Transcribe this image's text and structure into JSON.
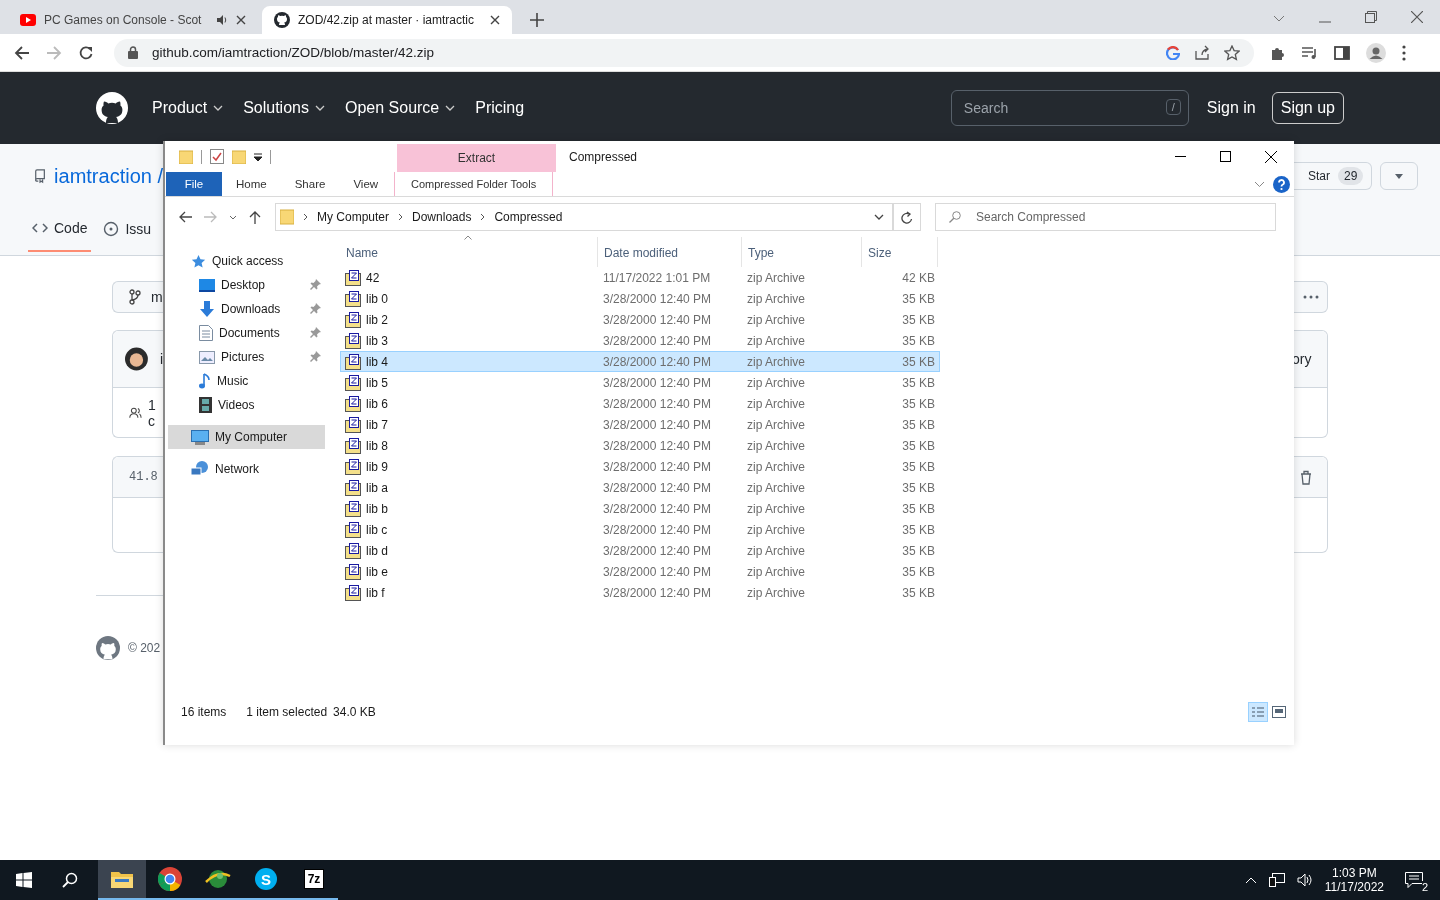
{
  "browser": {
    "tabs": [
      {
        "title": "PC Games on Console - Scot",
        "selected": false,
        "audio": true,
        "kind": "video"
      },
      {
        "title": "ZOD/42.zip at master · iamtractic",
        "selected": true,
        "audio": false,
        "kind": "github"
      }
    ],
    "url": "github.com/iamtraction/ZOD/blob/master/42.zip"
  },
  "github": {
    "nav": [
      {
        "label": "Product",
        "dropdown": true
      },
      {
        "label": "Solutions",
        "dropdown": true
      },
      {
        "label": "Open Source",
        "dropdown": true
      },
      {
        "label": "Pricing",
        "dropdown": false
      }
    ],
    "search": {
      "placeholder": "Search",
      "key": "/"
    },
    "sign_in": "Sign in",
    "sign_up": "Sign up",
    "owner": "iamtraction /",
    "repo_tabs": [
      {
        "label": "Code",
        "selected": true
      },
      {
        "label": "Issu",
        "selected": false
      }
    ],
    "branch": "m",
    "commit_author": "i",
    "contributors": "1 c",
    "file_size": "41.8",
    "footer": "© 202",
    "star": {
      "label": "Star",
      "count": "29"
    },
    "history": "ory"
  },
  "explorer": {
    "title": "Compressed",
    "context_tab": "Extract",
    "ribbon_tabs": [
      {
        "label": "File",
        "kind": "file"
      },
      {
        "label": "Home",
        "kind": "tab"
      },
      {
        "label": "Share",
        "kind": "tab"
      },
      {
        "label": "View",
        "kind": "tab"
      },
      {
        "label": "Compressed Folder Tools",
        "kind": "context"
      }
    ],
    "breadcrumbs": [
      "My Computer",
      "Downloads",
      "Compressed"
    ],
    "search": {
      "placeholder": "Search Compressed"
    },
    "nav": [
      {
        "label": "Quick access",
        "kind": "quick",
        "selected": false,
        "children": [
          {
            "label": "Desktop",
            "kind": "desktop",
            "pinned": true,
            "selected": false
          },
          {
            "label": "Downloads",
            "kind": "downloads",
            "pinned": true,
            "selected": false
          },
          {
            "label": "Documents",
            "kind": "documents",
            "pinned": true,
            "selected": false
          },
          {
            "label": "Pictures",
            "kind": "pictures",
            "pinned": true,
            "selected": false
          },
          {
            "label": "Music",
            "kind": "music",
            "pinned": false,
            "selected": false
          },
          {
            "label": "Videos",
            "kind": "videos",
            "pinned": false,
            "selected": false
          }
        ]
      },
      {
        "label": "My Computer",
        "kind": "computer",
        "selected": true
      },
      {
        "label": "Network",
        "kind": "network",
        "selected": false
      }
    ],
    "columns": [
      "Name",
      "Date modified",
      "Type",
      "Size"
    ],
    "files": [
      {
        "name": "42",
        "date": "11/17/2022 1:01 PM",
        "type": "zip Archive",
        "size": "42 KB",
        "selected": false
      },
      {
        "name": "lib 0",
        "date": "3/28/2000 12:40 PM",
        "type": "zip Archive",
        "size": "35 KB",
        "selected": false
      },
      {
        "name": "lib 2",
        "date": "3/28/2000 12:40 PM",
        "type": "zip Archive",
        "size": "35 KB",
        "selected": false
      },
      {
        "name": "lib 3",
        "date": "3/28/2000 12:40 PM",
        "type": "zip Archive",
        "size": "35 KB",
        "selected": false
      },
      {
        "name": "lib 4",
        "date": "3/28/2000 12:40 PM",
        "type": "zip Archive",
        "size": "35 KB",
        "selected": true
      },
      {
        "name": "lib 5",
        "date": "3/28/2000 12:40 PM",
        "type": "zip Archive",
        "size": "35 KB",
        "selected": false
      },
      {
        "name": "lib 6",
        "date": "3/28/2000 12:40 PM",
        "type": "zip Archive",
        "size": "35 KB",
        "selected": false
      },
      {
        "name": "lib 7",
        "date": "3/28/2000 12:40 PM",
        "type": "zip Archive",
        "size": "35 KB",
        "selected": false
      },
      {
        "name": "lib 8",
        "date": "3/28/2000 12:40 PM",
        "type": "zip Archive",
        "size": "35 KB",
        "selected": false
      },
      {
        "name": "lib 9",
        "date": "3/28/2000 12:40 PM",
        "type": "zip Archive",
        "size": "35 KB",
        "selected": false
      },
      {
        "name": "lib a",
        "date": "3/28/2000 12:40 PM",
        "type": "zip Archive",
        "size": "35 KB",
        "selected": false
      },
      {
        "name": "lib b",
        "date": "3/28/2000 12:40 PM",
        "type": "zip Archive",
        "size": "35 KB",
        "selected": false
      },
      {
        "name": "lib c",
        "date": "3/28/2000 12:40 PM",
        "type": "zip Archive",
        "size": "35 KB",
        "selected": false
      },
      {
        "name": "lib d",
        "date": "3/28/2000 12:40 PM",
        "type": "zip Archive",
        "size": "35 KB",
        "selected": false
      },
      {
        "name": "lib e",
        "date": "3/28/2000 12:40 PM",
        "type": "zip Archive",
        "size": "35 KB",
        "selected": false
      },
      {
        "name": "lib f",
        "date": "3/28/2000 12:40 PM",
        "type": "zip Archive",
        "size": "35 KB",
        "selected": false
      }
    ],
    "status": {
      "count": "16 items",
      "selection": "1 item selected",
      "size": "34.0 KB"
    }
  },
  "taskbar": {
    "apps": [
      {
        "kind": "explorer",
        "selected": true
      },
      {
        "kind": "chrome",
        "selected": false
      },
      {
        "kind": "globe",
        "selected": false
      },
      {
        "kind": "skype",
        "selected": false,
        "glyph": "S"
      },
      {
        "kind": "sevenzip",
        "selected": false,
        "glyph": "7z"
      }
    ],
    "time": "1:03 PM",
    "date": "11/17/2022",
    "notifications": "2"
  }
}
